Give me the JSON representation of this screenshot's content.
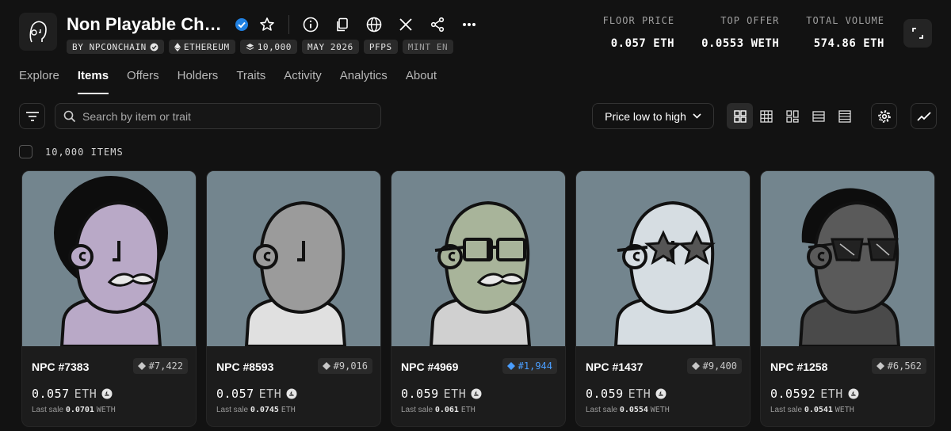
{
  "collection": {
    "title": "Non Playable Characters",
    "chips": [
      {
        "label": "BY NPCONCHAIN",
        "icon": "verified-icon"
      },
      {
        "label": "ETHEREUM",
        "icon": "ethereum-icon"
      },
      {
        "label": "10,000",
        "icon": "layers-icon"
      },
      {
        "label": "MAY 2026"
      },
      {
        "label": "PFPS"
      },
      {
        "label": "MINT EN"
      }
    ]
  },
  "stats": [
    {
      "label": "FLOOR PRICE",
      "value": "0.057 ETH"
    },
    {
      "label": "TOP OFFER",
      "value": "0.0553 WETH"
    },
    {
      "label": "TOTAL VOLUME",
      "value": "574.86 ETH"
    }
  ],
  "tabs": [
    {
      "label": "Explore",
      "active": false
    },
    {
      "label": "Items",
      "active": true
    },
    {
      "label": "Offers",
      "active": false
    },
    {
      "label": "Holders",
      "active": false
    },
    {
      "label": "Traits",
      "active": false
    },
    {
      "label": "Activity",
      "active": false
    },
    {
      "label": "Analytics",
      "active": false
    },
    {
      "label": "About",
      "active": false
    }
  ],
  "search": {
    "placeholder": "Search by item or trait"
  },
  "sort": {
    "label": "Price low to high"
  },
  "items_count": "10,000 ITEMS",
  "items": [
    {
      "name": "NPC #7383",
      "rank": "#7,422",
      "rank_color": "gray",
      "price": "0.057",
      "currency": "ETH",
      "last_sale_label": "Last sale",
      "last_sale_value": "0.0701",
      "last_sale_currency": "WETH",
      "skin": "#b9a9c7",
      "shirt": "#b9a9c7",
      "hair": "afro",
      "beard": true,
      "acc": "none"
    },
    {
      "name": "NPC #8593",
      "rank": "#9,016",
      "rank_color": "gray",
      "price": "0.057",
      "currency": "ETH",
      "last_sale_label": "Last sale",
      "last_sale_value": "0.0745",
      "last_sale_currency": "ETH",
      "skin": "#9b9b9b",
      "shirt": "#e0e0e0",
      "hair": "none",
      "beard": false,
      "acc": "none"
    },
    {
      "name": "NPC #4969",
      "rank": "#1,944",
      "rank_color": "blue",
      "price": "0.059",
      "currency": "ETH",
      "last_sale_label": "Last sale",
      "last_sale_value": "0.061",
      "last_sale_currency": "ETH",
      "skin": "#a8b49a",
      "shirt": "#d0d0d0",
      "hair": "none",
      "beard": true,
      "acc": "glasses"
    },
    {
      "name": "NPC #1437",
      "rank": "#9,400",
      "rank_color": "gray",
      "price": "0.059",
      "currency": "ETH",
      "last_sale_label": "Last sale",
      "last_sale_value": "0.0554",
      "last_sale_currency": "WETH",
      "skin": "#d6dde2",
      "shirt": "#d6dde2",
      "hair": "none",
      "beard": false,
      "acc": "stars"
    },
    {
      "name": "NPC #1258",
      "rank": "#6,562",
      "rank_color": "gray",
      "price": "0.0592",
      "currency": "ETH",
      "last_sale_label": "Last sale",
      "last_sale_value": "0.0541",
      "last_sale_currency": "WETH",
      "skin": "#5a5a5a",
      "shirt": "#4a4a4a",
      "hair": "waves",
      "beard": false,
      "acc": "shades"
    }
  ]
}
